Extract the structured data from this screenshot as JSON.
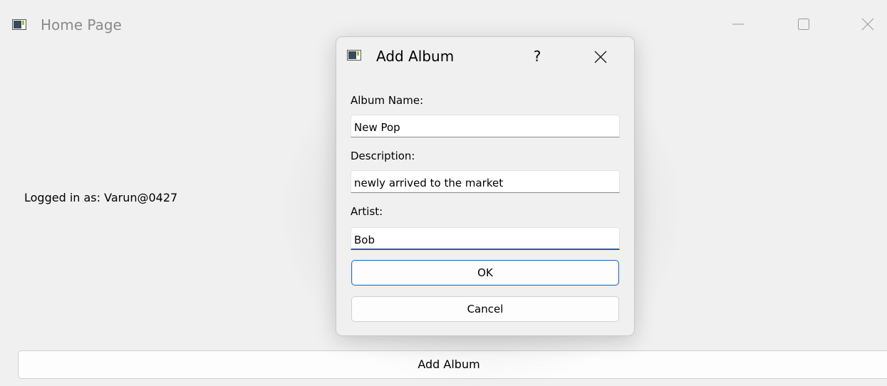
{
  "main_window": {
    "title": "Home Page",
    "logged_in_text": "Logged in as: Varun@0427",
    "add_album_button_label": "Add Album"
  },
  "dialog": {
    "title": "Add Album",
    "help_label": "?",
    "fields": {
      "album_name": {
        "label": "Album Name:",
        "value": "New Pop"
      },
      "description": {
        "label": "Description:",
        "value": "newly arrived to the market"
      },
      "artist": {
        "label": "Artist:",
        "value": "Bob"
      }
    },
    "ok_label": "OK",
    "cancel_label": "Cancel"
  },
  "icons": {
    "app": "app-window-icon",
    "minimize": "minimize-icon",
    "maximize": "maximize-icon",
    "close": "close-icon"
  },
  "colors": {
    "window_bg": "#f0f0f0",
    "focus_accent": "#1f5fae",
    "title_inactive": "#8a8a8a"
  }
}
